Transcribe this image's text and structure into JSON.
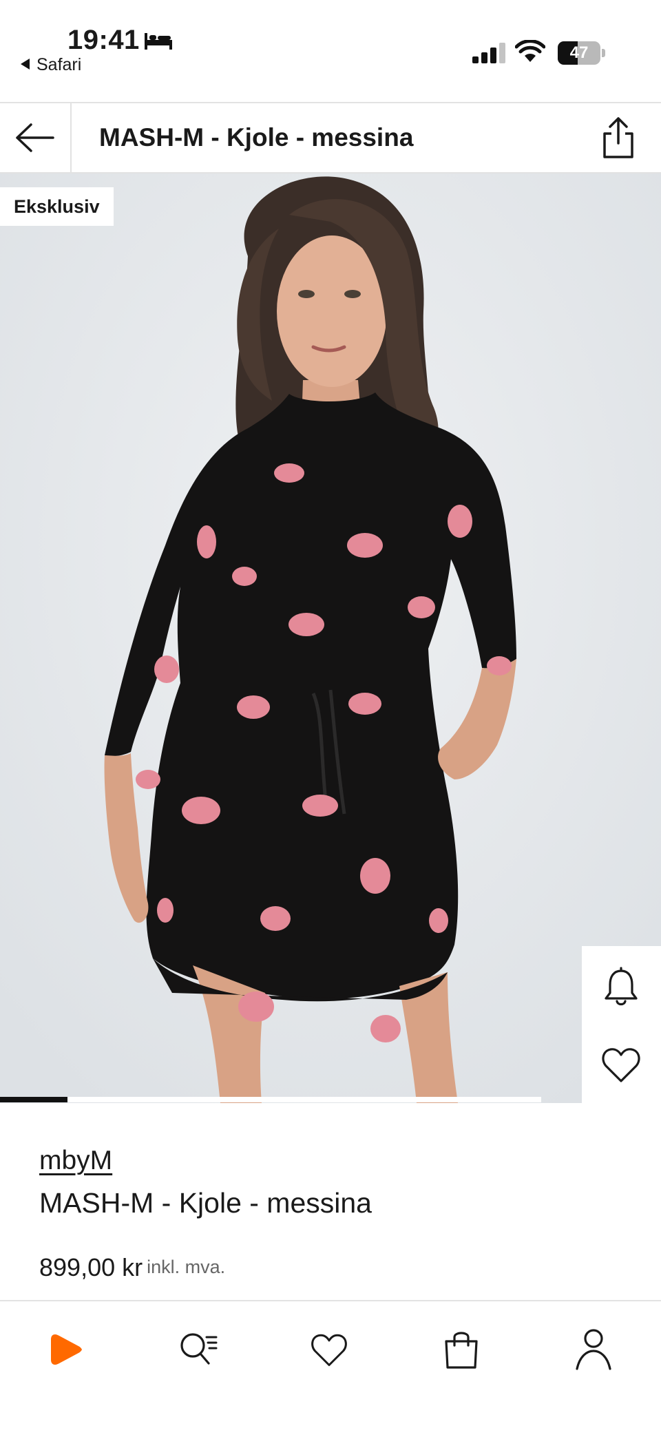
{
  "status_bar": {
    "time": "19:41",
    "back_app": "Safari",
    "battery_level": "47",
    "icons": [
      "bed-icon",
      "signal-icon",
      "wifi-icon",
      "battery-icon"
    ]
  },
  "header": {
    "title": "MASH-M - Kjole - messina",
    "back_icon": "arrow-left-icon",
    "share_icon": "share-icon"
  },
  "image": {
    "badge": "Eksklusiv",
    "carousel_progress": 0.125,
    "side_actions": [
      "bell-icon",
      "heart-icon"
    ]
  },
  "product": {
    "brand": "mbyM",
    "name": "MASH-M - Kjole - messina",
    "price": "899,00 kr",
    "tax_note": "inkl. mva."
  },
  "tabbar": {
    "items": [
      "home-icon",
      "search-icon",
      "wishlist-icon",
      "bag-icon",
      "profile-icon"
    ]
  },
  "colors": {
    "accent": "#ff6900",
    "text": "#1a1a1a",
    "divider": "#e2e2e2",
    "image_bg": "#e6e9ec",
    "flower": "#e48a98"
  }
}
